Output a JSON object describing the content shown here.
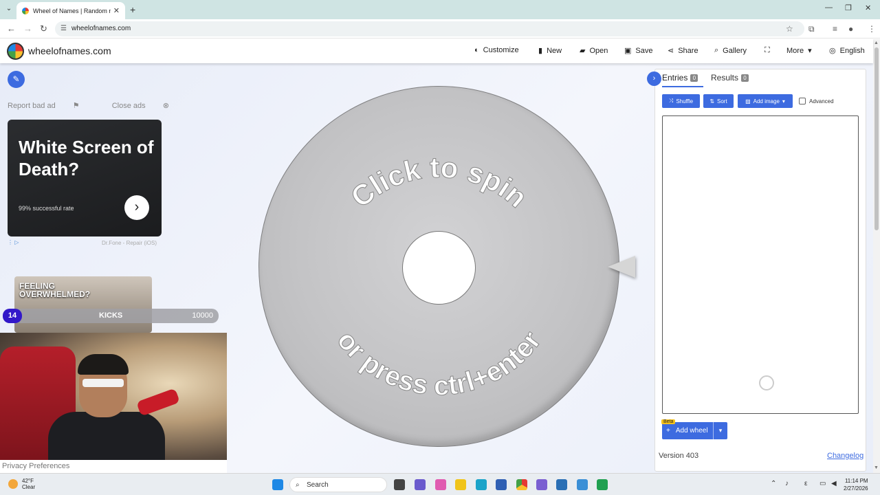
{
  "browser": {
    "tab_title": "Wheel of Names | Random nam",
    "url": "wheelofnames.com"
  },
  "site": {
    "brand": "wheelofnames.com",
    "menu": [
      {
        "label": "Customize",
        "icon": "palette-icon"
      },
      {
        "label": "New",
        "icon": "file-icon"
      },
      {
        "label": "Open",
        "icon": "folder-icon"
      },
      {
        "label": "Save",
        "icon": "save-icon"
      },
      {
        "label": "Share",
        "icon": "share-icon"
      },
      {
        "label": "Gallery",
        "icon": "search-icon"
      },
      {
        "label": "",
        "icon": "fullscreen-icon"
      },
      {
        "label": "More",
        "icon": "chevron-down-icon"
      },
      {
        "label": "English",
        "icon": "globe-icon"
      }
    ]
  },
  "ads": {
    "report_bad_ad": "Report bad ad",
    "close_ads": "Close ads",
    "headline": "White Screen of Death?",
    "subline": "99% successful rate",
    "sponsor": "Dr.Fone - Repair (iOS)"
  },
  "stream_overlay": {
    "video_text": "FEELING OVERWHELMED?",
    "level": "14",
    "label": "KICKS",
    "value": "10000"
  },
  "privacy": "Privacy Preferences",
  "wheel": {
    "top_text": "Click to spin",
    "bottom_text": "or press ctrl+enter"
  },
  "panel": {
    "tabs": [
      {
        "label": "Entries",
        "count": "0"
      },
      {
        "label": "Results",
        "count": "0"
      }
    ],
    "buttons": {
      "shuffle": "Shuffle",
      "sort": "Sort",
      "add_image": "Add image",
      "advanced": "Advanced"
    },
    "beta": "Beta",
    "add_wheel": "Add wheel",
    "version": "Version 403",
    "changelog": "Changelog"
  },
  "taskbar": {
    "temp": "42°F",
    "condition": "Clear",
    "search": "Search",
    "time": "11:14 PM",
    "date": "2/27/2026"
  },
  "colors": {
    "accent": "#3d6be0",
    "wheel": "#c3c3c5",
    "kicks_badge": "#3218c9"
  }
}
